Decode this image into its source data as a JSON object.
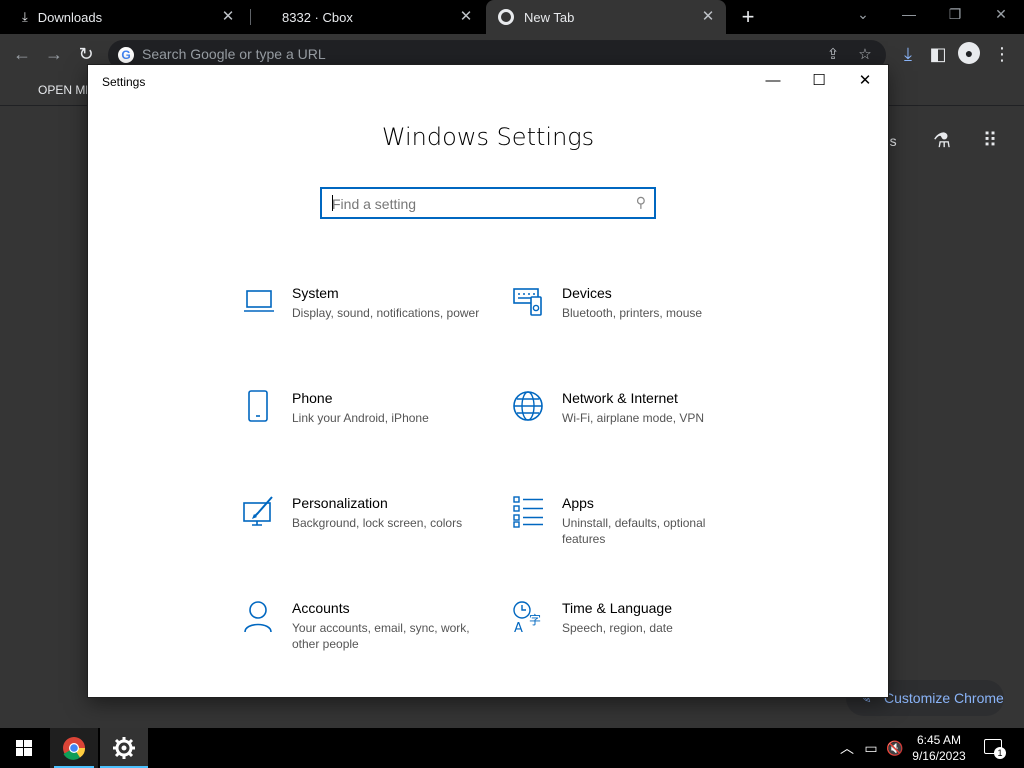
{
  "browser": {
    "tabs": [
      {
        "title": "Downloads"
      },
      {
        "title": "8332 · Cbox"
      },
      {
        "title": "New Tab"
      }
    ],
    "omnibox_placeholder": "Search Google or type a URL",
    "bookmark": "OPEN ME",
    "ntp": {
      "images_link": "ges",
      "customize_label": "Customize Chrome"
    }
  },
  "settings": {
    "window_title": "Settings",
    "heading": "Windows Settings",
    "search_placeholder": "Find a setting",
    "categories": [
      {
        "label": "System",
        "desc": "Display, sound, notifications, power",
        "icon": "laptop-icon"
      },
      {
        "label": "Devices",
        "desc": "Bluetooth, printers, mouse",
        "icon": "devices-icon"
      },
      {
        "label": "Phone",
        "desc": "Link your Android, iPhone",
        "icon": "phone-icon"
      },
      {
        "label": "Network & Internet",
        "desc": "Wi-Fi, airplane mode, VPN",
        "icon": "globe-icon"
      },
      {
        "label": "Personalization",
        "desc": "Background, lock screen, colors",
        "icon": "paintbrush-icon"
      },
      {
        "label": "Apps",
        "desc": "Uninstall, defaults, optional features",
        "icon": "apps-list-icon"
      },
      {
        "label": "Accounts",
        "desc": "Your accounts, email, sync, work, other people",
        "icon": "person-icon"
      },
      {
        "label": "Time & Language",
        "desc": "Speech, region, date",
        "icon": "time-language-icon"
      }
    ]
  },
  "taskbar": {
    "time": "6:45 AM",
    "date": "9/16/2023",
    "notification_count": "1"
  },
  "colors": {
    "accent": "#0067c0",
    "chrome_dark": "#353535"
  }
}
